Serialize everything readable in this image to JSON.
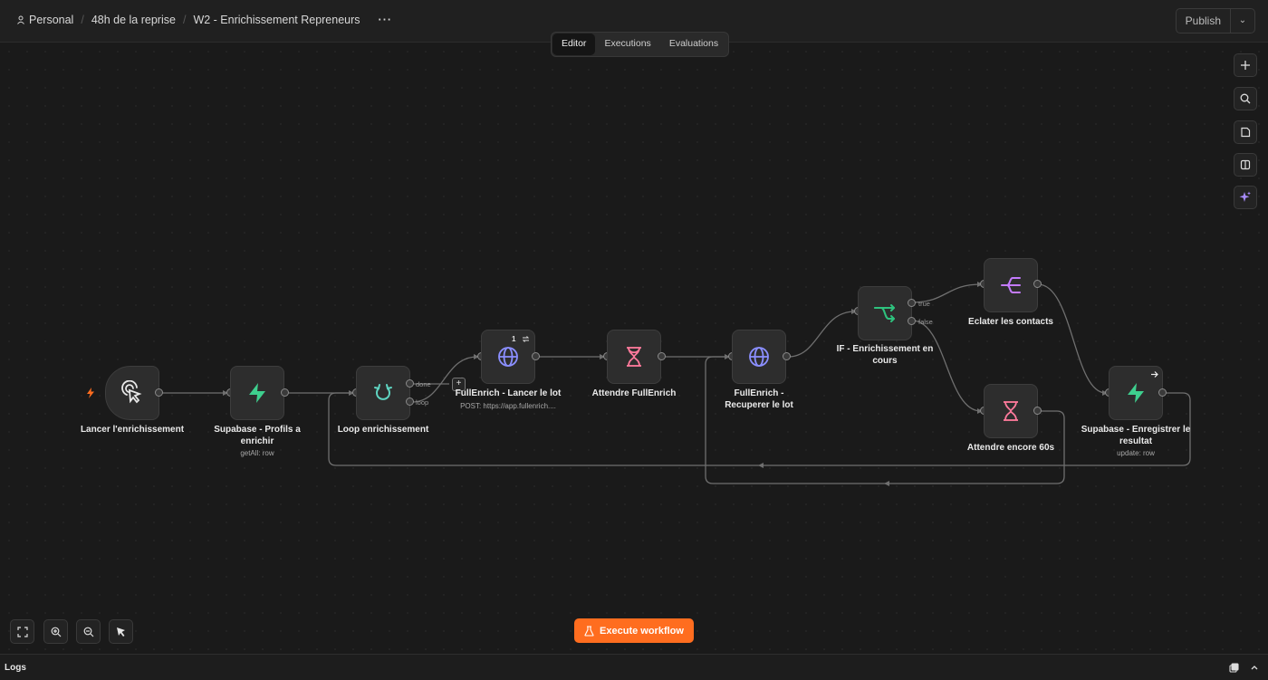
{
  "header": {
    "breadcrumb": {
      "project": "Personal",
      "folder": "48h de la reprise",
      "workflow": "W2 - Enrichissement Repreneurs"
    },
    "more_label": "···",
    "publish_label": "Publish",
    "tabs": [
      {
        "label": "Editor",
        "active": true
      },
      {
        "label": "Executions",
        "active": false
      },
      {
        "label": "Evaluations",
        "active": false
      }
    ]
  },
  "nodes": {
    "trigger": {
      "label": "Lancer l'enrichissement",
      "icon": "cursor-click-icon"
    },
    "supabase_get": {
      "label": "Supabase - Profils a enrichir",
      "sub": "getAll: row",
      "icon": "supabase-bolt-icon",
      "color": "#3ecf8e"
    },
    "loop": {
      "label": "Loop enrichissement",
      "icon": "loop-icon",
      "out_done": "done",
      "out_loop": "loop",
      "color": "#5fd4c1"
    },
    "fullenrich_launch": {
      "label": "FullEnrich - Lancer le lot",
      "sub": "POST: https://app.fullenrich....",
      "badge": "1",
      "icon": "globe-icon",
      "color": "#8b8fff"
    },
    "wait_fullenrich": {
      "label": "Attendre FullEnrich",
      "icon": "hourglass-icon",
      "color": "#ff7a9c"
    },
    "fullenrich_get": {
      "label": "FullEnrich - Recuperer le lot",
      "icon": "globe-icon",
      "color": "#8b8fff"
    },
    "if_enrich": {
      "label": "IF - Enrichissement en cours",
      "icon": "if-branch-icon",
      "out_true": "true",
      "out_false": "false",
      "color": "#2ec27e"
    },
    "split_contacts": {
      "label": "Eclater les contacts",
      "icon": "split-icon",
      "color": "#c47bff"
    },
    "wait_60": {
      "label": "Attendre encore 60s",
      "icon": "hourglass-icon",
      "color": "#ff7a9c"
    },
    "supabase_update": {
      "label": "Supabase - Enregistrer le resultat",
      "sub": "update: row",
      "icon": "supabase-bolt-icon",
      "color": "#3ecf8e"
    }
  },
  "toolbar_right": [
    "plus-icon",
    "search-icon",
    "sticky-note-icon",
    "panel-icon",
    "ai-sparkle-icon"
  ],
  "toolbar_bottom": [
    "fit-view-icon",
    "zoom-in-icon",
    "zoom-out-icon",
    "tidy-icon"
  ],
  "execute_label": "Execute workflow",
  "logs_label": "Logs",
  "colors": {
    "accent": "#ff6d1f",
    "trigger": "#ff6d1f"
  }
}
